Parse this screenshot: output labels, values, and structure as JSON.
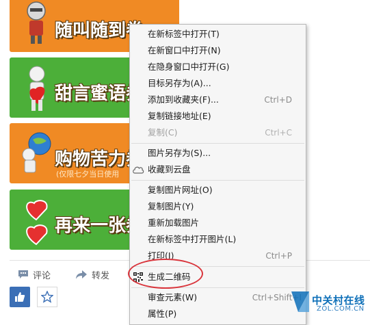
{
  "banners": [
    {
      "text": "随叫随到卷",
      "sub": ""
    },
    {
      "text": "甜言蜜语券",
      "sub": ""
    },
    {
      "text": "购物苦力券",
      "sub": "(仅限七夕当日使用"
    },
    {
      "text": "再来一张券",
      "sub": ""
    }
  ],
  "actions": {
    "comment": "评论",
    "share": "转发"
  },
  "menu": {
    "items": [
      {
        "label": "在新标签中打开(T)",
        "shortcut": ""
      },
      {
        "label": "在新窗口中打开(N)",
        "shortcut": ""
      },
      {
        "label": "在隐身窗口中打开(G)",
        "shortcut": ""
      },
      {
        "label": "目标另存为(A)...",
        "shortcut": ""
      },
      {
        "label": "添加到收藏夹(F)...",
        "shortcut": "Ctrl+D"
      },
      {
        "label": "复制链接地址(E)",
        "shortcut": ""
      },
      {
        "label": "复制(C)",
        "shortcut": "Ctrl+C"
      },
      {
        "label": "图片另存为(S)...",
        "shortcut": ""
      },
      {
        "label": "收藏到云盘",
        "shortcut": ""
      },
      {
        "label": "复制图片网址(O)",
        "shortcut": ""
      },
      {
        "label": "复制图片(Y)",
        "shortcut": ""
      },
      {
        "label": "重新加载图片",
        "shortcut": ""
      },
      {
        "label": "在新标签中打开图片(L)",
        "shortcut": ""
      },
      {
        "label": "打印(I)",
        "shortcut": "Ctrl+P"
      },
      {
        "label": "生成二维码",
        "shortcut": ""
      },
      {
        "label": "审查元素(W)",
        "shortcut": "Ctrl+Shift+I"
      },
      {
        "label": "属性(P)",
        "shortcut": ""
      }
    ]
  },
  "icons": {
    "comment": "comment-icon",
    "share": "share-arrow-icon",
    "like": "thumbs-up-icon",
    "favorite": "star-icon",
    "cloud": "cloud-icon",
    "qr": "qr-code-icon"
  },
  "colors": {
    "orange_banner": "#f08a24",
    "green_banner": "#4caf39",
    "highlight": "#d9343b",
    "like_button": "#3b6fb6",
    "watermark": "#0d6fb8"
  },
  "watermark": {
    "name": "中关村在线",
    "url": "ZOL.COM.CN"
  }
}
